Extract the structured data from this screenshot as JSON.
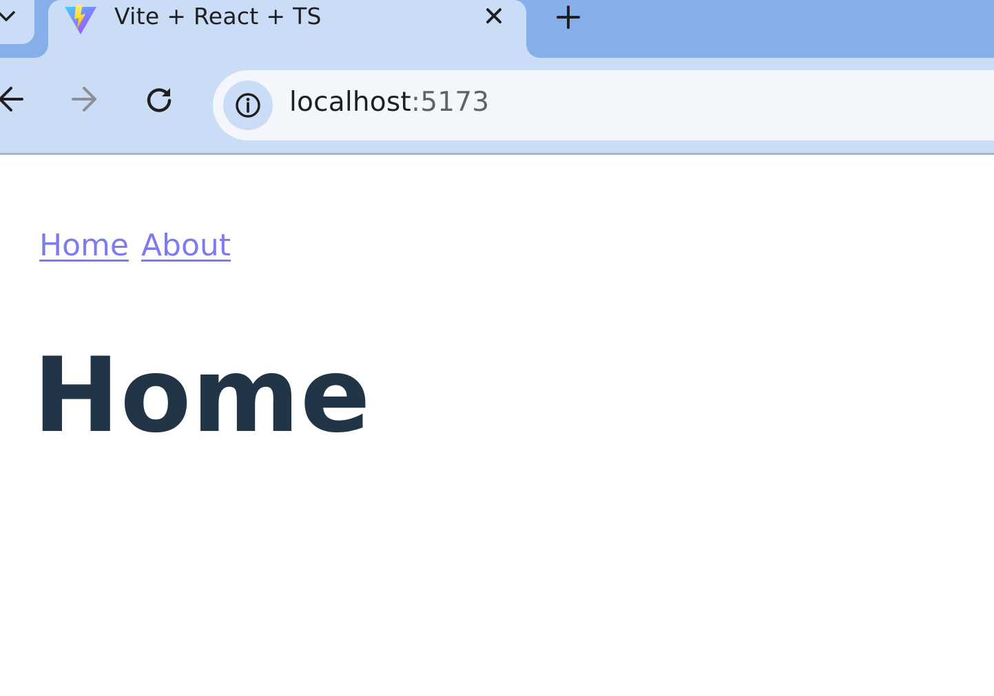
{
  "browser": {
    "tab": {
      "title": "Vite + React + TS",
      "favicon": "vite-logo-icon",
      "close_icon": "close-icon"
    },
    "new_tab_icon": "plus-icon",
    "tab_list_icon": "chevron-down-icon",
    "toolbar": {
      "back_icon": "arrow-left-icon",
      "forward_icon": "arrow-right-icon",
      "reload_icon": "reload-icon",
      "site_info_icon": "info-icon"
    },
    "address_bar": {
      "host": "localhost",
      "port": ":5173"
    },
    "colors": {
      "tabstrip": "#85aeea",
      "active_tab": "#cadcf6",
      "omnibox": "#f3f7fc"
    }
  },
  "page": {
    "nav": {
      "links": [
        {
          "label": "Home"
        },
        {
          "label": "About"
        }
      ]
    },
    "heading": "Home",
    "colors": {
      "link": "#7c7cf0",
      "heading": "#213547"
    }
  }
}
